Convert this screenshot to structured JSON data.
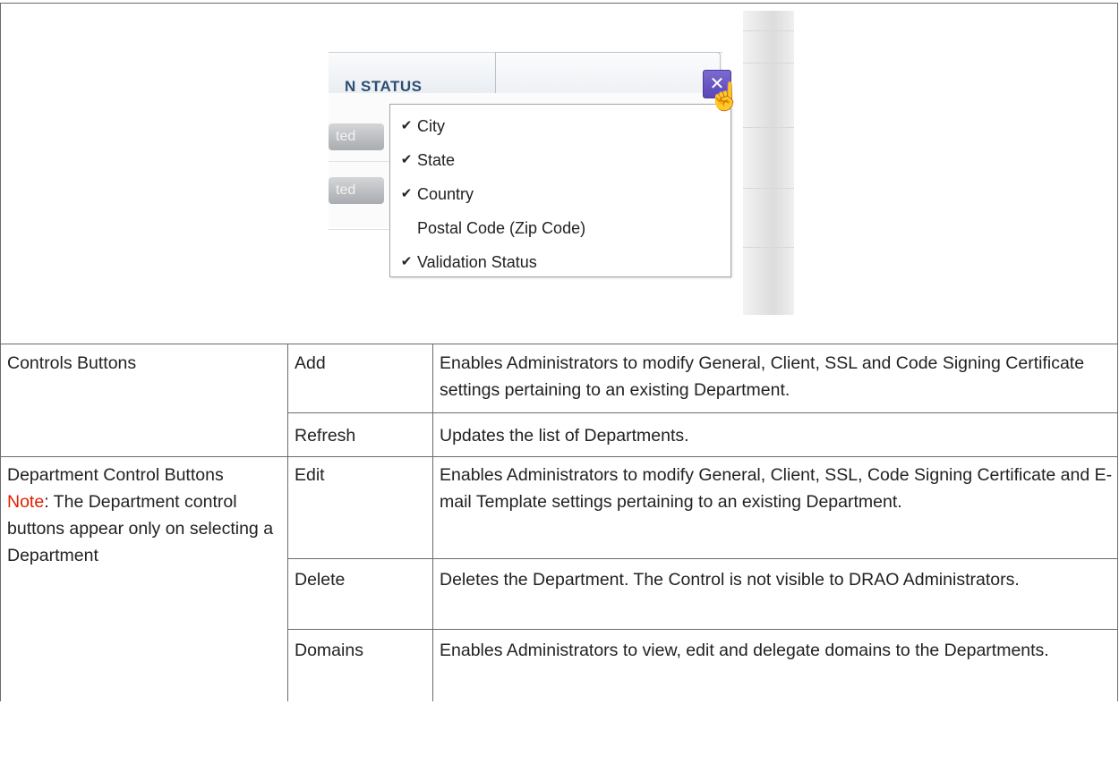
{
  "screenshot": {
    "column_title": "N STATUS",
    "row_pills": [
      "ted",
      "ted"
    ],
    "menu_items": [
      {
        "label": "City",
        "checked": "✔"
      },
      {
        "label": "State",
        "checked": "✔"
      },
      {
        "label": "Country",
        "checked": "✔"
      },
      {
        "label": "Postal Code (Zip Code)",
        "checked": ""
      },
      {
        "label": "Validation Status",
        "checked": "✔"
      }
    ],
    "tool_icon": "wrench-screwdriver-icon",
    "cursor_icon": "hand-pointer-icon"
  },
  "table": {
    "rows": [
      {
        "group": "Controls Buttons",
        "button": "Add",
        "description": "Enables Administrators to modify General, Client, SSL and Code Signing Certificate settings pertaining to an existing Department."
      },
      {
        "button": "Refresh",
        "description": "Updates the list of Departments."
      },
      {
        "group": "Department Control Buttons",
        "note_label": "Note",
        "note_text": ": The Department control buttons appear only on selecting a Department",
        "button": "Edit",
        "description": "Enables Administrators to modify General, Client, SSL, Code Signing Certificate and E-mail Template settings pertaining to an existing Department."
      },
      {
        "button": "Delete",
        "description": "Deletes the Department. The Control is not visible to DRAO Administrators."
      },
      {
        "button": "Domains",
        "description": "Enables Administrators to view, edit and delegate domains to the Departments."
      }
    ]
  },
  "colors": {
    "note": "#e02000",
    "tool_button": "#6a57c4",
    "column_title": "#2d4f73"
  }
}
